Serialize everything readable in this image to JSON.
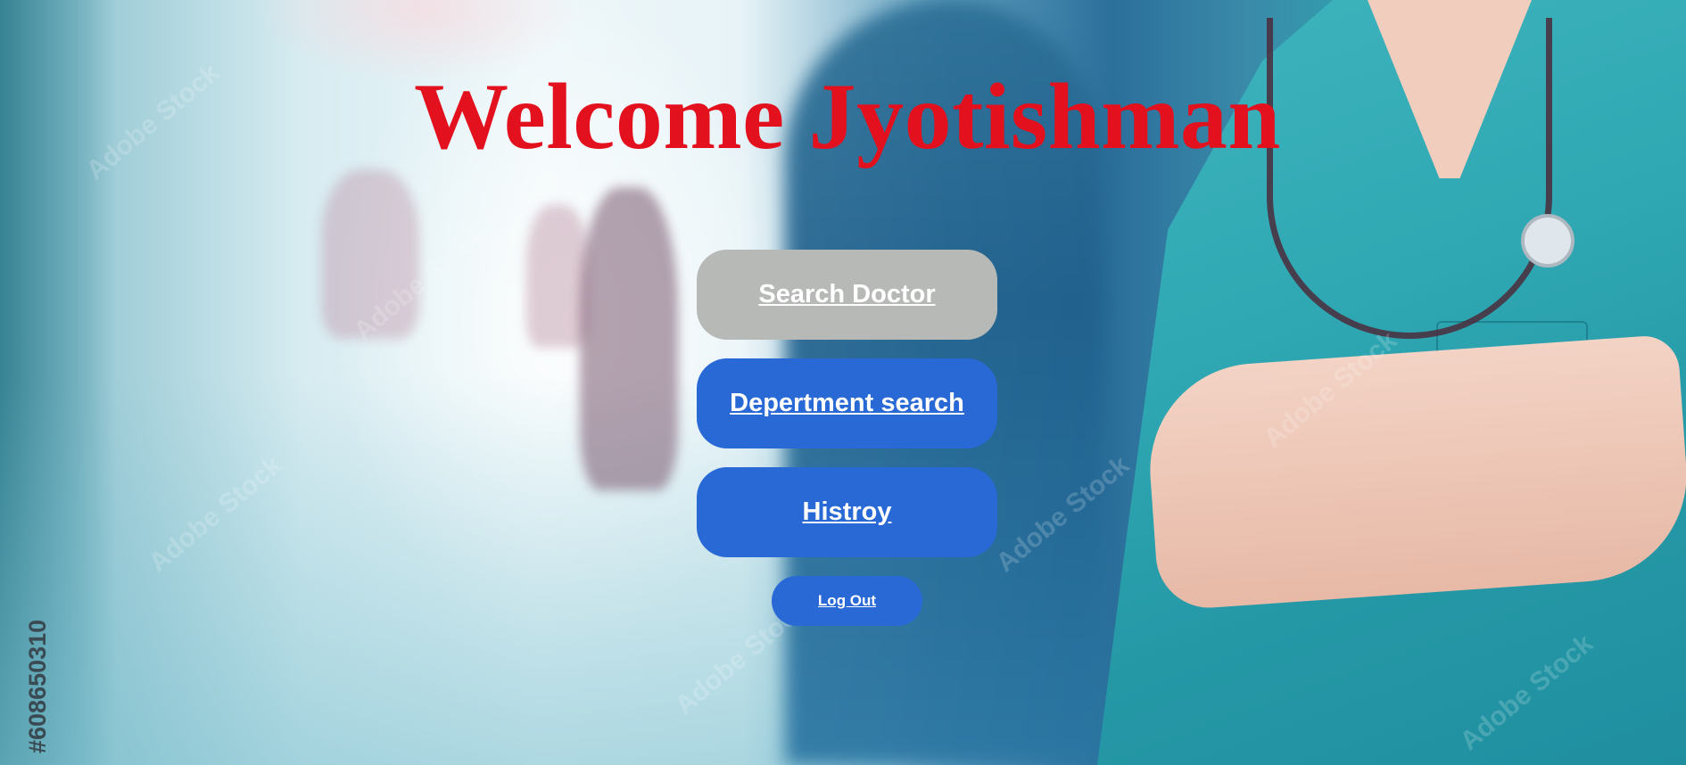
{
  "page": {
    "title": "Welcome Jyotishman",
    "background_image": "hospital corridor with doctor in teal scrubs and stethoscope",
    "stock_id": "#608650310",
    "watermark": "Adobe Stock"
  },
  "buttons": {
    "search_doctor": "Search Doctor",
    "department_search": "Depertment search",
    "history": "Histroy",
    "logout": "Log Out"
  },
  "colors": {
    "title": "#e3101d",
    "primary_button": "#2869d6",
    "active_button": "#b7b9b7",
    "button_text": "#ffffff"
  }
}
